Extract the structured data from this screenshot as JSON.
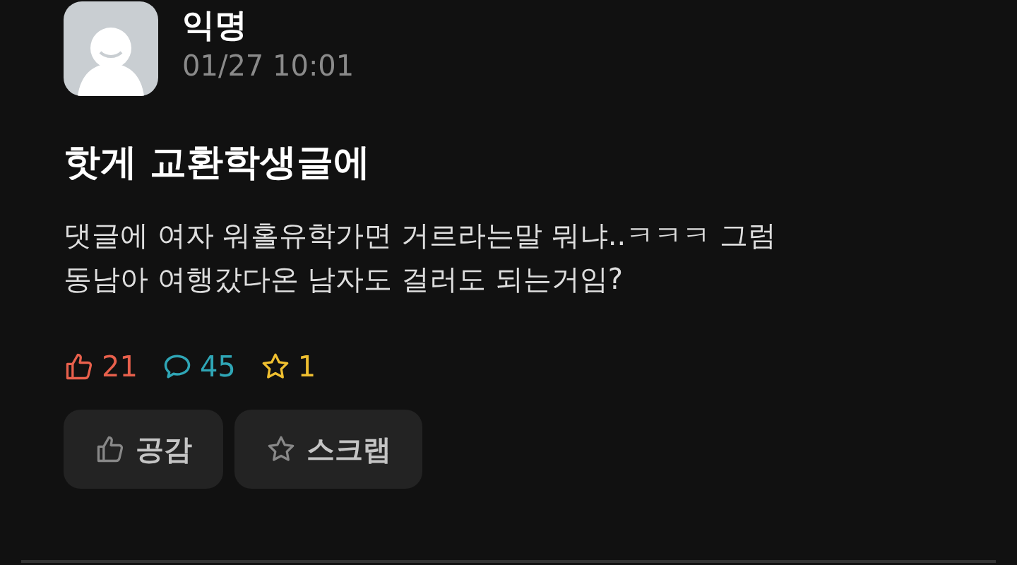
{
  "post": {
    "author": "익명",
    "time": "01/27 10:01",
    "title": "핫게 교환학생글에",
    "body": [
      "댓글에 여자 워홀유학가면 거르라는말 뭐냐..ㅋㅋㅋ 그럼",
      "동남아 여행갔다온 남자도 걸러도 되는거임?"
    ]
  },
  "stats": [
    {
      "kind": "like",
      "count": "21",
      "color": "#e8604c"
    },
    {
      "kind": "comment",
      "count": "45",
      "color": "#2fa6b6"
    },
    {
      "kind": "scrap",
      "count": "1",
      "color": "#f0c030"
    }
  ],
  "buttons": [
    {
      "kind": "like",
      "label": "공감"
    },
    {
      "kind": "scrap",
      "label": "스크랩"
    }
  ]
}
